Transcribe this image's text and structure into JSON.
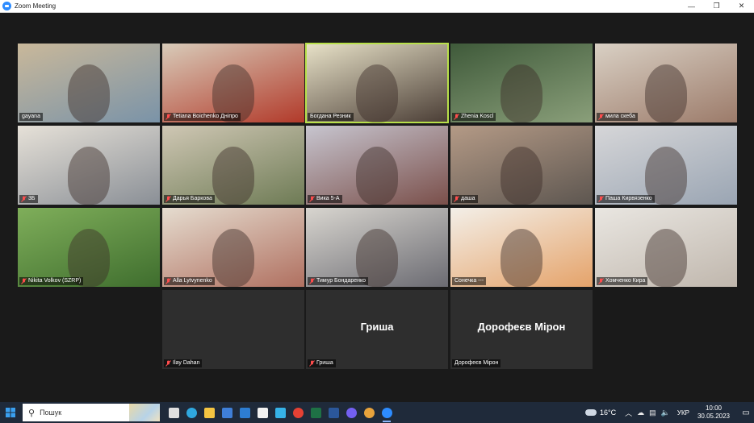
{
  "window": {
    "title": "Zoom Meeting",
    "controls": {
      "minimize": "—",
      "maximize": "❐",
      "close": "✕"
    }
  },
  "participants": [
    {
      "name": "gayana",
      "muted": false,
      "video": true
    },
    {
      "name": "Tetiana Boichenko  Дніпро",
      "muted": true,
      "video": true
    },
    {
      "name": "Богдана Резник",
      "muted": false,
      "video": true,
      "active_speaker": true
    },
    {
      "name": "Zhenia Koscl",
      "muted": true,
      "video": true
    },
    {
      "name": "мила скеба",
      "muted": true,
      "video": true
    },
    {
      "name": "3Б",
      "muted": true,
      "video": true
    },
    {
      "name": "Дарья Баркова",
      "muted": true,
      "video": true
    },
    {
      "name": "Вика 5-А",
      "muted": true,
      "video": true
    },
    {
      "name": "даша",
      "muted": true,
      "video": true
    },
    {
      "name": "Паша Кирвязенко",
      "muted": true,
      "video": true
    },
    {
      "name": "Nikita Volkov (SZRP)",
      "muted": true,
      "video": true
    },
    {
      "name": "Alla Lytvynenko",
      "muted": true,
      "video": true
    },
    {
      "name": "Тимур Бондаренко",
      "muted": true,
      "video": true
    },
    {
      "name": "Сонечка ---",
      "muted": false,
      "video": true
    },
    {
      "name": "Хомченко Кира",
      "muted": true,
      "video": true
    },
    {
      "name": "Ilay Dahan",
      "muted": true,
      "video": false,
      "display_name": ""
    },
    {
      "name": "Гриша",
      "muted": true,
      "video": false,
      "display_name": "Гриша"
    },
    {
      "name": "Дорофеєв Мірон",
      "muted": false,
      "video": false,
      "display_name": "Дорофеєв Мірон"
    }
  ],
  "taskbar": {
    "search_placeholder": "Пошук",
    "apps": [
      {
        "name": "task-view",
        "color": "#e0e0e0"
      },
      {
        "name": "edge",
        "color": "#2fa8e0"
      },
      {
        "name": "file-explorer",
        "color": "#f4c542"
      },
      {
        "name": "microsoft-store",
        "color": "#3f7fd8"
      },
      {
        "name": "mail",
        "color": "#2d7dd2"
      },
      {
        "name": "amazon",
        "color": "#f2f2f2"
      },
      {
        "name": "mydr",
        "color": "#36b3e8"
      },
      {
        "name": "chrome",
        "color": "#e44134"
      },
      {
        "name": "excel",
        "color": "#1e7145"
      },
      {
        "name": "word",
        "color": "#2b579a"
      },
      {
        "name": "viber",
        "color": "#7360f2"
      },
      {
        "name": "paint",
        "color": "#e8a33c"
      },
      {
        "name": "zoom",
        "color": "#2d8cff"
      }
    ],
    "weather": "16°C",
    "language": "УКР",
    "time": "10:00",
    "date": "30.05.2023"
  }
}
